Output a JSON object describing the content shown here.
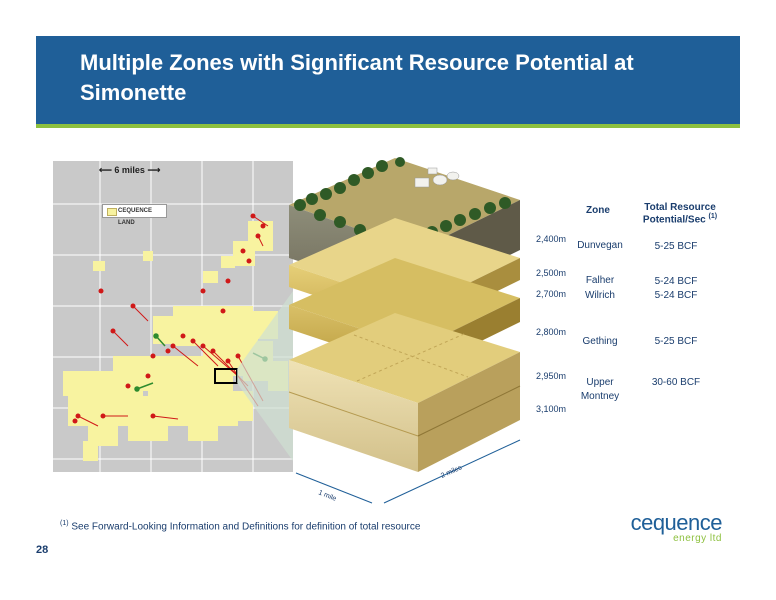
{
  "slide": {
    "title": "Multiple Zones with Significant Resource Potential at Simonette",
    "page_number": "28",
    "footnote_marker": "(1)",
    "footnote_text": "See Forward-Looking Information and Definitions for definition of total resource"
  },
  "map": {
    "scale_label": "6 miles",
    "legend_label": "CEQUENCE LAND"
  },
  "block": {
    "scale_1": "1 mile",
    "scale_2": "2 miles"
  },
  "table": {
    "header_zone": "Zone",
    "header_potential_line1": "Total Resource",
    "header_potential_line2": "Potential/Sec",
    "header_potential_sup": "(1)",
    "depths": [
      "2,400m",
      "2,500m",
      "2,700m",
      "2,800m",
      "2,950m",
      "3,100m"
    ],
    "rows": [
      {
        "zone": "Dunvegan",
        "potential": "5-25 BCF"
      },
      {
        "zone": "Falher",
        "potential": "5-24 BCF"
      },
      {
        "zone": "Wilrich",
        "potential": "5-24 BCF"
      },
      {
        "zone": "Gething",
        "potential": "5-25 BCF"
      },
      {
        "zone": "Upper",
        "zone2": "Montney",
        "potential": "30-60 BCF"
      }
    ]
  },
  "logo": {
    "name": "cequence",
    "sub": "energy ltd"
  },
  "colors": {
    "header_bg": "#1f5f98",
    "header_rule": "#8dc03f",
    "text": "#1a3d6d",
    "land": "#f8f3a0",
    "wells": "#d01818"
  }
}
